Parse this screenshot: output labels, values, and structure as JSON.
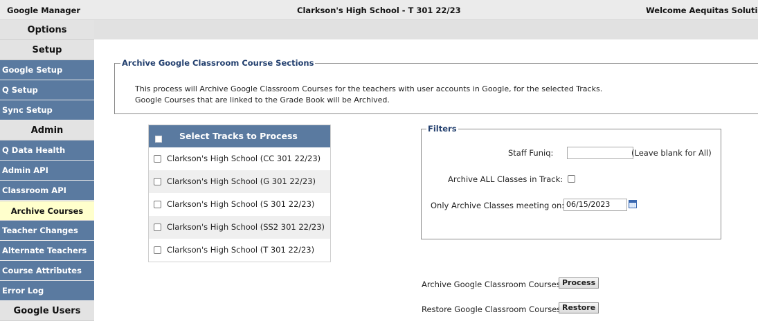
{
  "topbar": {
    "app_name": "Google Manager",
    "school": "Clarkson's High School - T 301 22/23",
    "welcome": "Welcome Aequitas Solutio"
  },
  "sidebar": {
    "options_label": "Options",
    "setup_label": "Setup",
    "setup_items": [
      "Google Setup",
      "Q Setup",
      "Sync Setup"
    ],
    "admin_label": "Admin",
    "admin_items": [
      "Q Data Health",
      "Admin API",
      "Classroom API",
      "Archive Courses",
      "Teacher Changes",
      "Alternate Teachers",
      "Course Attributes",
      "Error Log"
    ],
    "active_item": "Archive Courses",
    "google_users_label": "Google Users"
  },
  "archive": {
    "legend": "Archive Google Classroom Course Sections",
    "line1": "This process will Archive Google Classroom Courses for the teachers with user accounts in Google, for the selected Tracks.",
    "line2": "Google Courses that are linked to the Grade Book will be Archived."
  },
  "tracks": {
    "header": "Select Tracks to Process",
    "rows": [
      "Clarkson's High School (CC 301 22/23)",
      "Clarkson's High School (G 301 22/23)",
      "Clarkson's High School (S 301 22/23)",
      "Clarkson's High School (SS2 301 22/23)",
      "Clarkson's High School (T 301 22/23)"
    ]
  },
  "filters": {
    "legend": "Filters",
    "staff_label": "Staff Funiq:",
    "staff_value": "",
    "staff_hint": "(Leave blank for All)",
    "archive_all_label": "Archive ALL Classes in Track:",
    "only_archive_label": "Only Archive Classes meeting on:",
    "date_value": "06/15/2023"
  },
  "actions": {
    "archive_label": "Archive Google Classroom Courses",
    "process_button": "Process",
    "restore_label": "Restore Google Classroom Courses",
    "restore_button": "Restore"
  },
  "colors": {
    "sidebar_blue": "#5a7aa0",
    "active_yellow": "#ffffcc",
    "legend_navy": "#223f6e"
  }
}
